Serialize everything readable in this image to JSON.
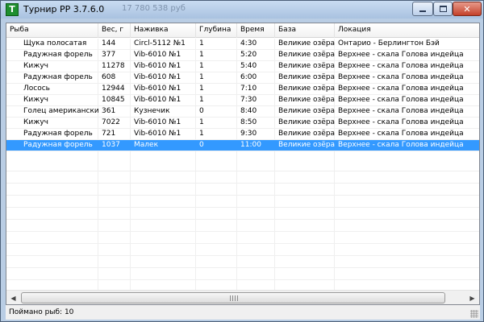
{
  "window": {
    "title": "Турнир РР 3.7.6.0",
    "icon_letter": "T",
    "ghost_caption": "17 780 538 руб",
    "controls": {
      "minimize_icon": "minimize-icon",
      "maximize_icon": "maximize-icon",
      "close_icon": "close-icon"
    }
  },
  "table": {
    "columns": [
      "Рыба",
      "Вес, г",
      "Наживка",
      "Глубина",
      "Время",
      "База",
      "Локация"
    ],
    "rows": [
      [
        "Щука полосатая",
        "144",
        "Circl-5112 №1",
        "1",
        "4:30",
        "Великие озёра",
        "Онтарио - Берлингтон Бэй"
      ],
      [
        "Радужная форель",
        "377",
        "Vib-6010 №1",
        "1",
        "5:20",
        "Великие озёра",
        "Верхнее - скала Голова индейца"
      ],
      [
        "Кижуч",
        "11278",
        "Vib-6010 №1",
        "1",
        "5:40",
        "Великие озёра",
        "Верхнее - скала Голова индейца"
      ],
      [
        "Радужная форель",
        "608",
        "Vib-6010 №1",
        "1",
        "6:00",
        "Великие озёра",
        "Верхнее - скала Голова индейца"
      ],
      [
        "Лосось",
        "12944",
        "Vib-6010 №1",
        "1",
        "7:10",
        "Великие озёра",
        "Верхнее - скала Голова индейца"
      ],
      [
        "Кижуч",
        "10845",
        "Vib-6010 №1",
        "1",
        "7:30",
        "Великие озёра",
        "Верхнее - скала Голова индейца"
      ],
      [
        "Голец американский",
        "361",
        "Кузнечик",
        "0",
        "8:40",
        "Великие озёра",
        "Верхнее - скала Голова индейца"
      ],
      [
        "Кижуч",
        "7022",
        "Vib-6010 №1",
        "1",
        "8:50",
        "Великие озёра",
        "Верхнее - скала Голова индейца"
      ],
      [
        "Радужная форель",
        "721",
        "Vib-6010 №1",
        "1",
        "9:30",
        "Великие озёра",
        "Верхнее - скала Голова индейца"
      ],
      [
        "Радужная форель",
        "1037",
        "Малек",
        "0",
        "11:00",
        "Великие озёра",
        "Верхнее - скала Голова индейца"
      ]
    ],
    "selected_row_index": 9,
    "selection_color": "#3399ff"
  },
  "status": {
    "caught_text": "Поймано рыб: 10"
  },
  "colors": {
    "title_bar": "#b9cde4",
    "close_button": "#c4412a",
    "app_icon": "#1f8f2f"
  }
}
